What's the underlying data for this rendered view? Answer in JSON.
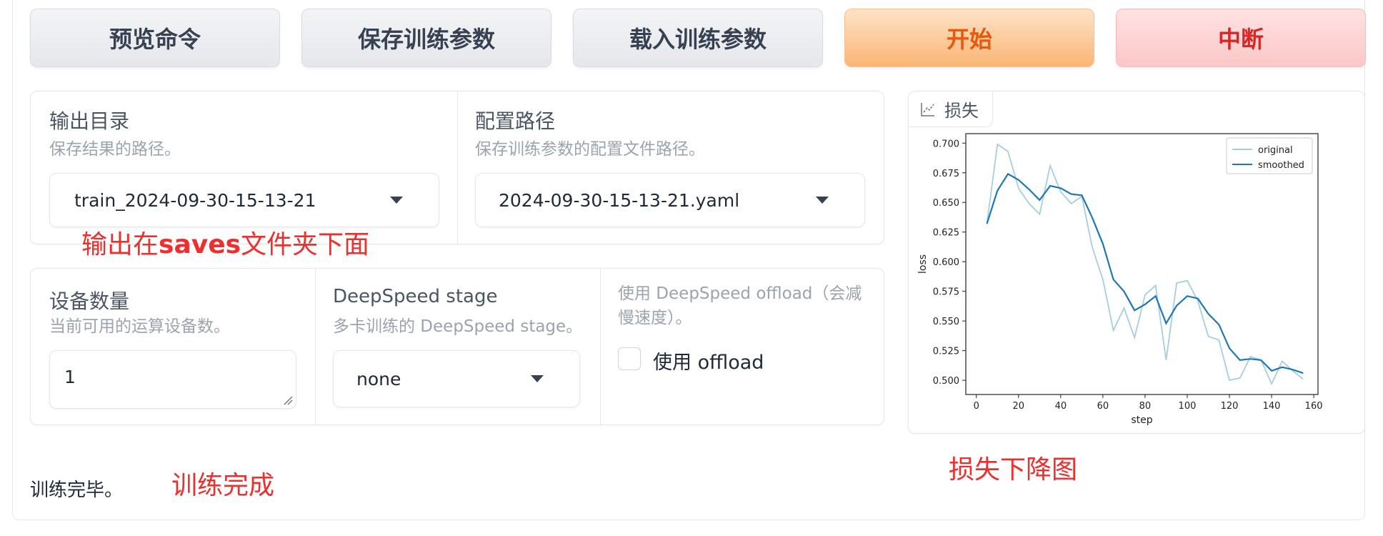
{
  "toolbar": {
    "preview_label": "预览命令",
    "save_label": "保存训练参数",
    "load_label": "载入训练参数",
    "start_label": "开始",
    "stop_label": "中断"
  },
  "output": {
    "dir_label": "输出目录",
    "dir_info": "保存结果的路径。",
    "dir_value": "train_2024-09-30-15-13-21",
    "config_label": "配置路径",
    "config_info": "保存训练参数的配置文件路径。",
    "config_value": "2024-09-30-15-13-21.yaml"
  },
  "devices": {
    "count_label": "设备数量",
    "count_info": "当前可用的运算设备数。",
    "count_value": "1",
    "ds_label": "DeepSpeed stage",
    "ds_info": "多卡训练的 DeepSpeed stage。",
    "ds_value": "none",
    "offload_info": "使用 DeepSpeed offload（会减慢速度）。",
    "offload_label": "使用 offload",
    "offload_checked": false
  },
  "status": {
    "text": "训练完毕。"
  },
  "annotations": {
    "saves_prefix": "输出在",
    "saves_bold": "saves",
    "saves_suffix": "文件夹下面",
    "done": "训练完成",
    "loss_down": "损失下降图"
  },
  "plot": {
    "tab_label": "损失",
    "icon": "line-chart-icon"
  },
  "chart_data": {
    "type": "line",
    "xlabel": "step",
    "ylabel": "loss",
    "xlim": [
      -5,
      162
    ],
    "ylim": [
      0.488,
      0.708
    ],
    "xticks": [
      0,
      20,
      40,
      60,
      80,
      100,
      120,
      140,
      160
    ],
    "yticks": [
      0.5,
      0.525,
      0.55,
      0.575,
      0.6,
      0.625,
      0.65,
      0.675,
      0.7
    ],
    "legend_position": "top-right",
    "colors": {
      "original": "#a6cee3",
      "smoothed": "#1f78b4"
    },
    "x": [
      5,
      10,
      15,
      20,
      25,
      30,
      35,
      40,
      45,
      50,
      55,
      60,
      65,
      70,
      75,
      80,
      85,
      90,
      95,
      100,
      105,
      110,
      115,
      120,
      125,
      130,
      135,
      140,
      145,
      150,
      155
    ],
    "series": [
      {
        "name": "original",
        "values": [
          0.632,
          0.699,
          0.693,
          0.662,
          0.649,
          0.64,
          0.681,
          0.659,
          0.649,
          0.655,
          0.612,
          0.585,
          0.542,
          0.561,
          0.536,
          0.572,
          0.58,
          0.517,
          0.582,
          0.584,
          0.567,
          0.537,
          0.534,
          0.5,
          0.502,
          0.52,
          0.517,
          0.497,
          0.516,
          0.508,
          0.501
        ]
      },
      {
        "name": "smoothed",
        "values": [
          0.632,
          0.66,
          0.674,
          0.669,
          0.661,
          0.652,
          0.664,
          0.662,
          0.657,
          0.656,
          0.637,
          0.615,
          0.585,
          0.575,
          0.559,
          0.564,
          0.571,
          0.548,
          0.563,
          0.571,
          0.569,
          0.556,
          0.547,
          0.527,
          0.517,
          0.518,
          0.517,
          0.508,
          0.511,
          0.509,
          0.506
        ]
      }
    ]
  }
}
